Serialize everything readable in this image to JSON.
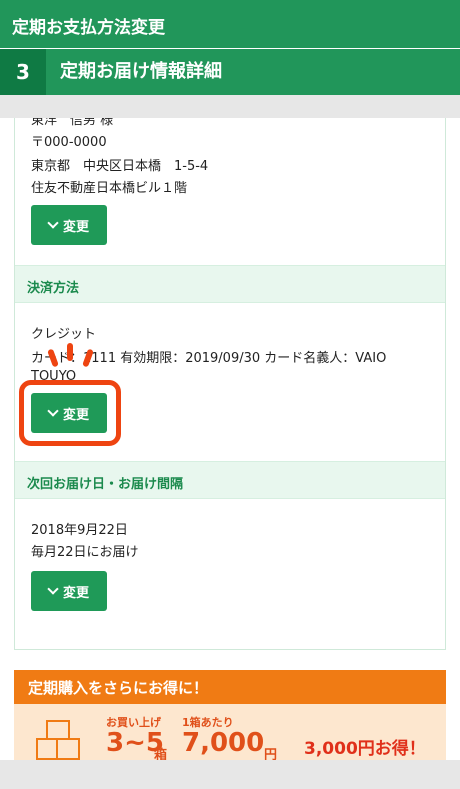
{
  "header": {
    "title": "定期お支払方法変更"
  },
  "step": {
    "number": "3",
    "title": "定期お届け情報詳細"
  },
  "address": {
    "name": "東洋　信男 様",
    "postal": "〒000-0000",
    "line1": "東京都　中央区日本橋　1-5-4",
    "line2": "住友不動産日本橋ビル１階"
  },
  "change_label": "変更",
  "payment": {
    "heading": "決済方法",
    "method": "クレジット",
    "card_line": "カード：1111 有効期限：2019/09/30 カード名義人：VAIO",
    "card_line2": "TOUYO"
  },
  "delivery": {
    "heading": "次回お届け日・お届け間隔",
    "date": "2018年9月22日",
    "interval": "毎月22日にお届け"
  },
  "promo": {
    "title": "定期購入をさらにお得に！",
    "label1": "お買い上げ",
    "count": "3~5",
    "unit": "箱",
    "label2": "1箱あたり",
    "price": "7,000",
    "yen": "円",
    "saving": "3,000円お得！"
  },
  "colors": {
    "green": "#21965a",
    "highlight": "#ee4411",
    "promo": "#f07b14"
  }
}
